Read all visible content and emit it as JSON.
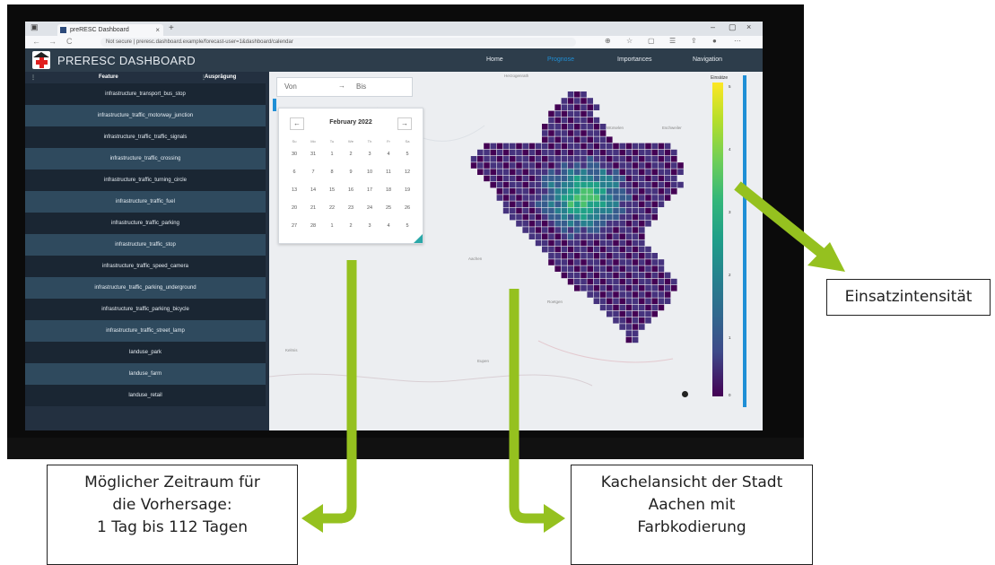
{
  "browser": {
    "tab_title": "preRESC Dashboard",
    "close_tab": "×",
    "new_tab": "+",
    "window_controls": {
      "minimize": "–",
      "maximize": "▢",
      "close": "×"
    },
    "url": "Not secure  |  preresc.dashboard.example/forecast-user=1&dashboard/calendar",
    "nav": {
      "back": "←",
      "forward": "→",
      "reload": "C"
    }
  },
  "app": {
    "title": "PRERESC DASHBOARD",
    "nav": [
      {
        "label": "Home",
        "active": false
      },
      {
        "label": "Prognose",
        "active": true
      },
      {
        "label": "Importances",
        "active": false
      },
      {
        "label": "Navigation",
        "active": false
      }
    ]
  },
  "sidebar": {
    "col_feature": "Feature",
    "col_value": "Ausprägung",
    "rows": [
      "infrastructure_transport_bus_stop",
      "infrastructure_traffic_motorway_junction",
      "infrastructure_traffic_traffic_signals",
      "infrastructure_traffic_crossing",
      "infrastructure_traffic_turning_circle",
      "infrastructure_traffic_fuel",
      "infrastructure_traffic_parking",
      "infrastructure_traffic_stop",
      "infrastructure_traffic_speed_camera",
      "infrastructure_traffic_parking_underground",
      "infrastructure_traffic_parking_bicycle",
      "infrastructure_traffic_street_lamp",
      "landuse_park",
      "landuse_farm",
      "landuse_retail"
    ]
  },
  "date_range": {
    "from": "Von",
    "arrow": "→",
    "to": "Bis"
  },
  "calendar": {
    "month": "February 2022",
    "prev": "←",
    "next": "→",
    "weekdays": [
      "Su",
      "Mo",
      "Tu",
      "We",
      "Th",
      "Fr",
      "Sa"
    ],
    "weeks": [
      [
        "30",
        "31",
        "1",
        "2",
        "3",
        "4",
        "5"
      ],
      [
        "6",
        "7",
        "8",
        "9",
        "10",
        "11",
        "12"
      ],
      [
        "13",
        "14",
        "15",
        "16",
        "17",
        "18",
        "19"
      ],
      [
        "20",
        "21",
        "22",
        "23",
        "24",
        "25",
        "26"
      ],
      [
        "27",
        "28",
        "1",
        "2",
        "3",
        "4",
        "5"
      ]
    ]
  },
  "map": {
    "places": [
      "Herzogenrath",
      "Würselen",
      "Eschweiler",
      "Stolberg",
      "Aachen",
      "Roetgen",
      "Eupen",
      "Kelmis"
    ],
    "colorbar_title": "Einsätze",
    "colorbar_ticks": [
      "5",
      "4",
      "3",
      "2",
      "1",
      "0"
    ],
    "colors": {
      "low": "#440154",
      "mid": "#21918c",
      "high": "#fde725"
    }
  },
  "annotations": {
    "intensity": "Einsatzintensität",
    "period_lines": [
      "Möglicher Zeitraum für",
      "die Vorhersage:",
      "1 Tag bis 112 Tagen"
    ],
    "tiles_lines": [
      "Kachelansicht der Stadt",
      "Aachen mit",
      "Farbkodierung"
    ],
    "arrow_color": "#95c11f"
  }
}
